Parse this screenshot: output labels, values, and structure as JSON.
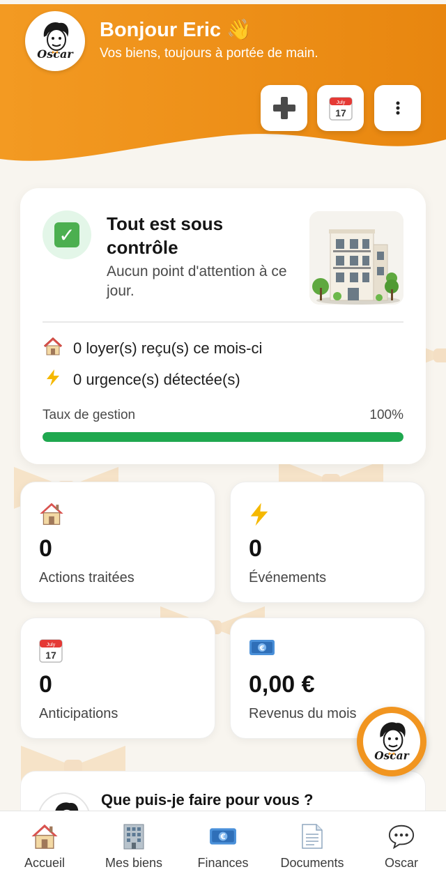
{
  "header": {
    "greeting": "Bonjour Eric 👋",
    "subtitle": "Vos biens, toujours à portée de main.",
    "logo_text": "Oscar",
    "buttons": [
      {
        "name": "add",
        "icon": "plus-icon"
      },
      {
        "name": "calendar",
        "icon": "calendar-icon",
        "month": "July",
        "day": "17"
      },
      {
        "name": "more",
        "icon": "more-vertical-icon"
      }
    ]
  },
  "status": {
    "title": "Tout est sous contrôle",
    "subtitle": "Aucun point d'attention à ce jour.",
    "rows": [
      {
        "icon": "house-icon",
        "text": "0 loyer(s) reçu(s) ce mois-ci"
      },
      {
        "icon": "lightning-icon",
        "text": "0 urgence(s) détectée(s)"
      }
    ],
    "rate_label": "Taux de gestion",
    "rate_value": "100%",
    "rate_fraction": 1.0
  },
  "stats": [
    {
      "icon": "house-icon",
      "value": "0",
      "label": "Actions traitées"
    },
    {
      "icon": "lightning-icon",
      "value": "0",
      "label": "Événements"
    },
    {
      "icon": "calendar-icon",
      "value": "0",
      "label": "Anticipations"
    },
    {
      "icon": "euro-banknote-icon",
      "value": "0,00 €",
      "label": "Revenus du mois"
    }
  ],
  "assistant": {
    "question": "Que puis-je faire pour vous ?"
  },
  "nav": [
    {
      "icon": "house-icon",
      "label": "Accueil"
    },
    {
      "icon": "office-building-icon",
      "label": "Mes biens"
    },
    {
      "icon": "euro-banknote-icon",
      "label": "Finances"
    },
    {
      "icon": "document-icon",
      "label": "Documents"
    },
    {
      "icon": "speech-bubble-icon",
      "label": "Oscar"
    }
  ],
  "colors": {
    "header_orange": "#f19520",
    "progress_green": "#1fa84f",
    "background": "#f8f5ef"
  }
}
